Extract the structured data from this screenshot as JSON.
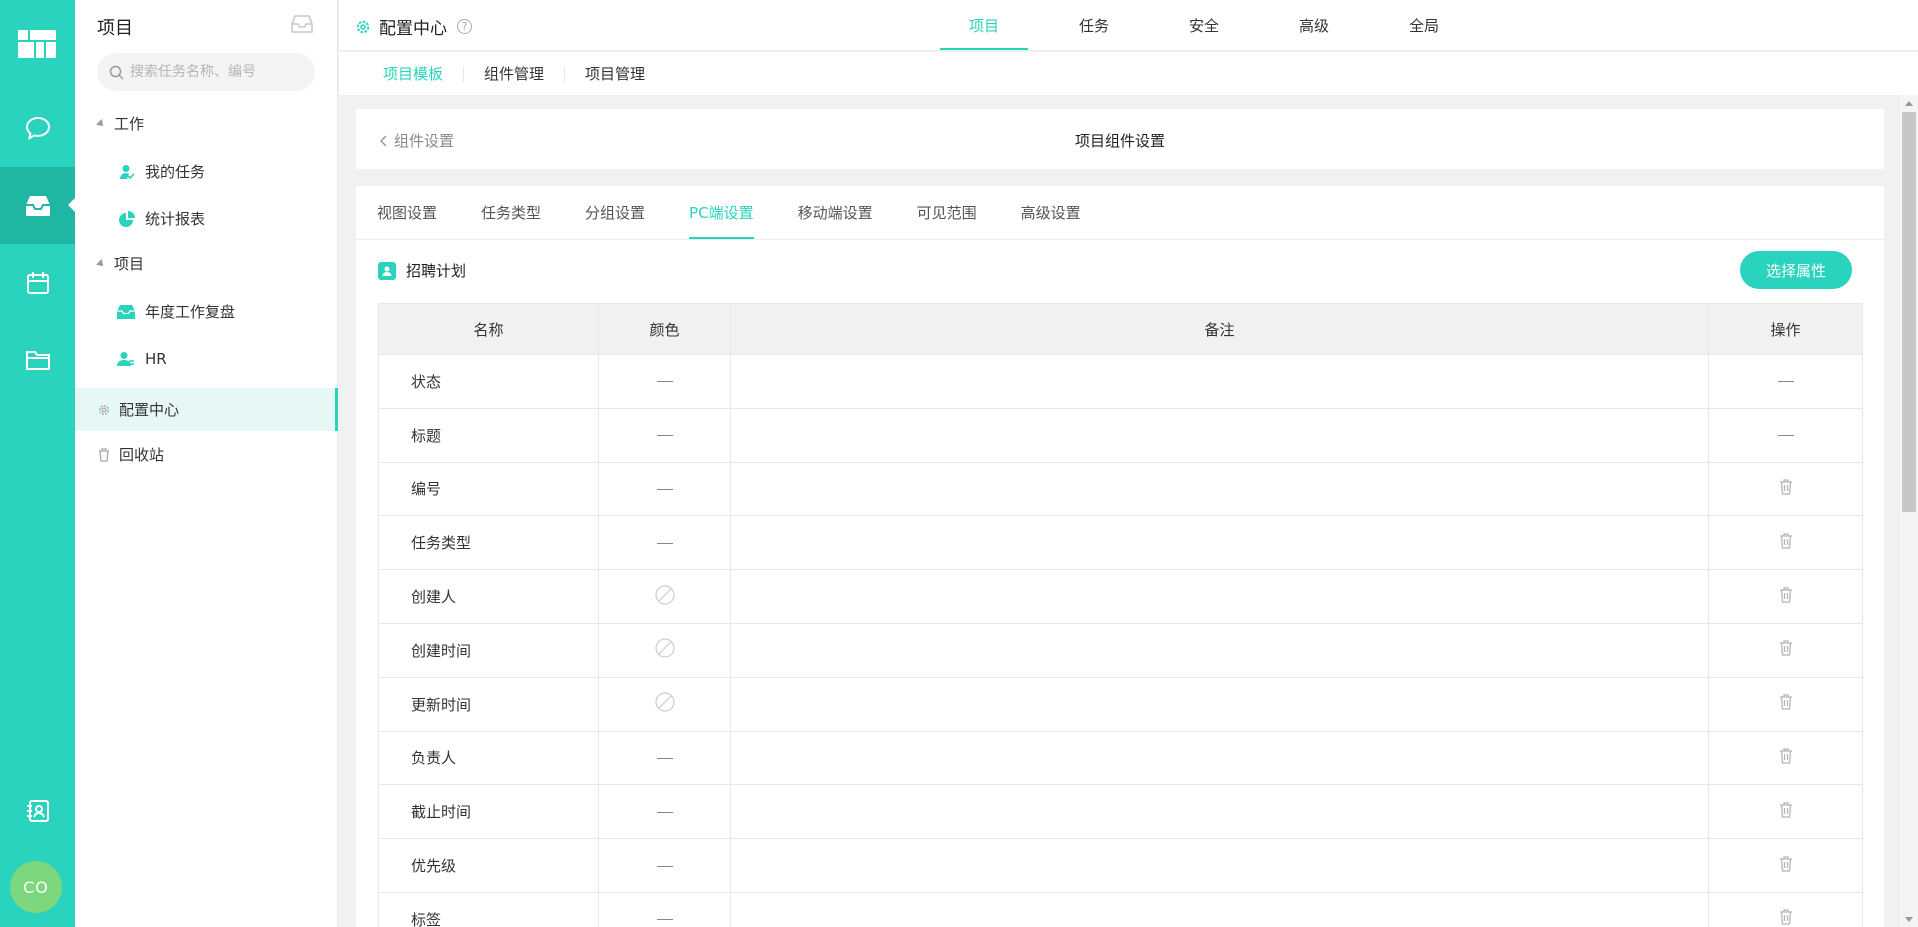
{
  "rail": {
    "avatar_text": "CO",
    "icons": [
      "logo-icon",
      "chat-icon",
      "inbox-icon",
      "calendar-icon",
      "folder-icon",
      "contacts-icon"
    ],
    "accent": "#2ad3bd"
  },
  "sidebar": {
    "title": "项目",
    "search_placeholder": "搜索任务名称、编号",
    "groups": [
      {
        "label": "工作",
        "items": [
          "我的任务",
          "统计报表"
        ]
      },
      {
        "label": "项目",
        "items": [
          "年度工作复盘",
          "HR"
        ]
      }
    ],
    "config_center": "配置中心",
    "recycle_bin": "回收站"
  },
  "header": {
    "title": "配置中心",
    "help": "?",
    "tabs": [
      "项目",
      "任务",
      "安全",
      "高级",
      "全局"
    ],
    "active_tab": "项目"
  },
  "subheader": {
    "tabs": [
      "项目模板",
      "组件管理",
      "项目管理"
    ],
    "active": "项目模板"
  },
  "crumb": {
    "back_label": "组件设置",
    "title": "项目组件设置"
  },
  "content_tabs": {
    "tabs": [
      "视图设置",
      "任务类型",
      "分组设置",
      "PC端设置",
      "移动端设置",
      "可见范围",
      "高级设置"
    ],
    "active": "PC端设置"
  },
  "section": {
    "title": "招聘计划",
    "pick_button": "选择属性"
  },
  "table": {
    "columns": [
      "名称",
      "颜色",
      "备注",
      "操作"
    ],
    "rows": [
      {
        "name": "状态",
        "color": "dash",
        "note": "",
        "action": "dash"
      },
      {
        "name": "标题",
        "color": "dash",
        "note": "",
        "action": "dash"
      },
      {
        "name": "编号",
        "color": "dash",
        "note": "",
        "action": "delete"
      },
      {
        "name": "任务类型",
        "color": "dash",
        "note": "",
        "action": "delete"
      },
      {
        "name": "创建人",
        "color": "none",
        "note": "",
        "action": "delete"
      },
      {
        "name": "创建时间",
        "color": "none",
        "note": "",
        "action": "delete"
      },
      {
        "name": "更新时间",
        "color": "none",
        "note": "",
        "action": "delete"
      },
      {
        "name": "负责人",
        "color": "dash",
        "note": "",
        "action": "delete"
      },
      {
        "name": "截止时间",
        "color": "dash",
        "note": "",
        "action": "delete"
      },
      {
        "name": "优先级",
        "color": "dash",
        "note": "",
        "action": "delete"
      },
      {
        "name": "标签",
        "color": "dash",
        "note": "",
        "action": "delete"
      }
    ]
  }
}
